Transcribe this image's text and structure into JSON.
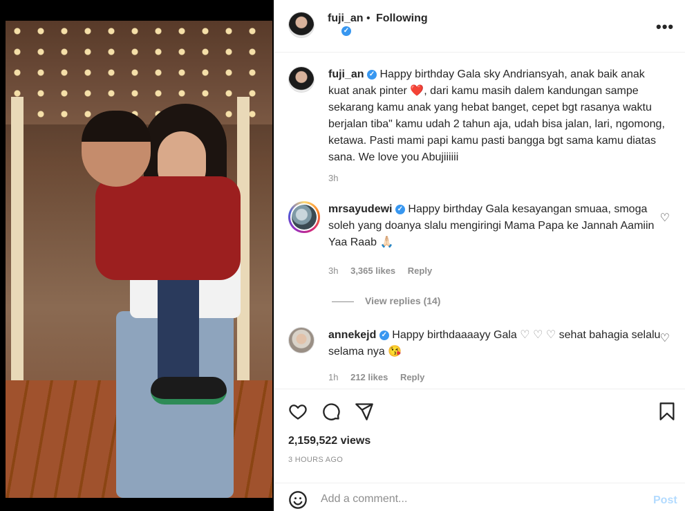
{
  "header": {
    "username": "fuji_an",
    "separator": "•",
    "follow_status": "Following",
    "verified_glyph": "✓",
    "more_glyph": "•••"
  },
  "caption": {
    "username": "fuji_an",
    "text_before_heart": "Happy birthday Gala sky Andriansyah, anak baik anak kuat anak pinter",
    "heart_glyph": "❤️",
    "text_after_heart": ", dari kamu masih dalem kandungan sampe sekarang kamu anak yang hebat banget, cepet bgt rasanya waktu berjalan tiba\" kamu udah 2 tahun aja, udah bisa jalan, lari, ngomong, ketawa. Pasti mami papi kamu pasti bangga bgt sama kamu diatas sana. We love you Abujiiiiii",
    "time": "3h"
  },
  "comments": [
    {
      "username": "mrsayudewi",
      "text": "Happy birthday Gala kesayangan smuaa, smoga soleh yang doanya slalu mengiringi Mama Papa ke Jannah Aamiin Yaa Raab",
      "emoji": "🙏🏻",
      "time": "3h",
      "likes": "3,365 likes",
      "reply": "Reply",
      "view_replies": "View replies (14)"
    },
    {
      "username": "annekejd",
      "text_before": "Happy birthdaaaayy Gala",
      "hearts": "♡ ♡ ♡",
      "text_after": "sehat bahagia selalu selama nya",
      "emoji": "😘",
      "time": "1h",
      "likes": "212 likes",
      "reply": "Reply"
    }
  ],
  "actions": {
    "views": "2,159,522 views",
    "posted": "3 HOURS AGO"
  },
  "add_comment": {
    "placeholder": "Add a comment...",
    "post": "Post"
  },
  "icons": [
    "heart-icon",
    "comment-icon",
    "share-icon",
    "bookmark-icon",
    "emoji-icon",
    "more-icon",
    "verified-icon"
  ],
  "colors": {
    "verified": "#3897f0",
    "post_disabled": "#b3dbff",
    "muted": "#8e8e8e",
    "heart": "#ed4956"
  }
}
